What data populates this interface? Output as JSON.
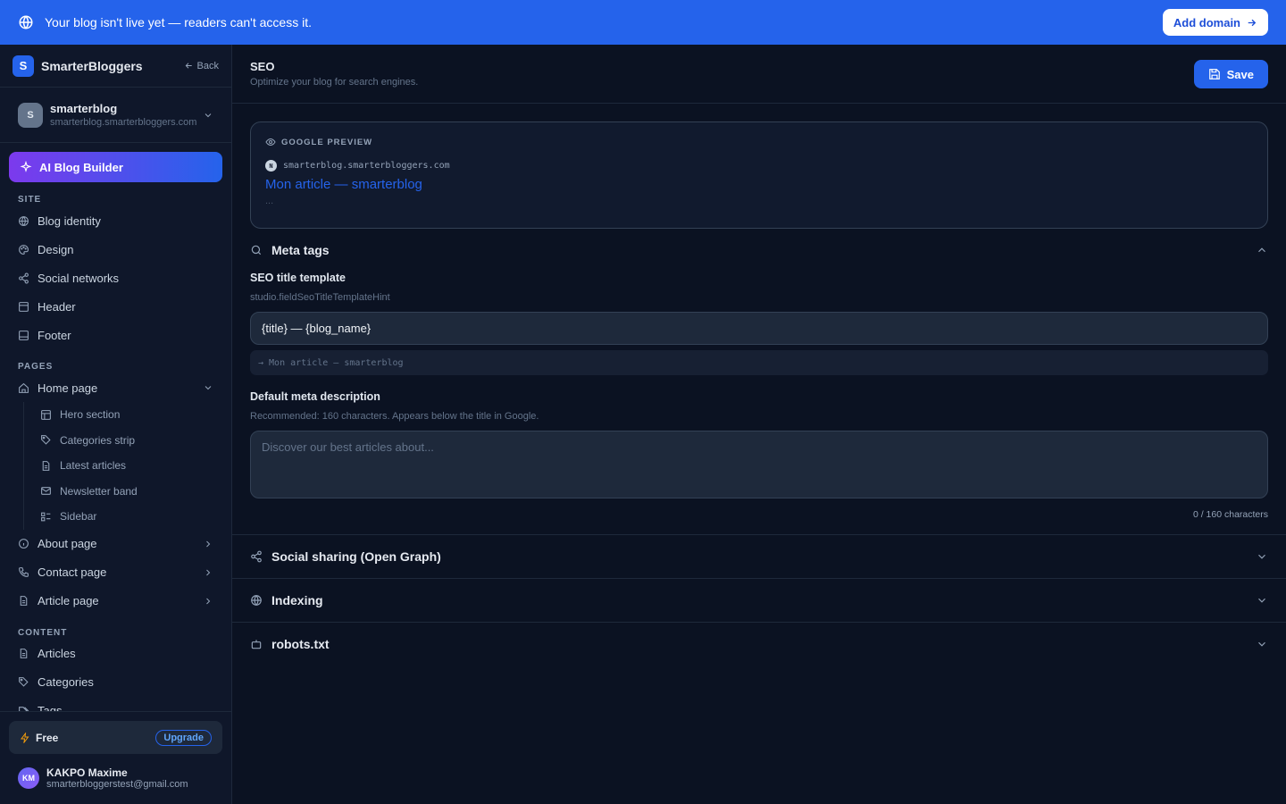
{
  "banner": {
    "message": "Your blog isn't live yet — readers can't access it.",
    "button": "Add domain"
  },
  "brand": {
    "logo": "S",
    "name": "SmarterBloggers",
    "back": "Back"
  },
  "blog": {
    "initial": "S",
    "name": "smarterblog",
    "domain": "smarterblog.smarterbloggers.com"
  },
  "ai_button": "AI Blog Builder",
  "nav": {
    "site_label": "SITE",
    "site": [
      {
        "label": "Blog identity",
        "icon": "globe-icon"
      },
      {
        "label": "Design",
        "icon": "palette-icon"
      },
      {
        "label": "Social networks",
        "icon": "share-icon"
      },
      {
        "label": "Header",
        "icon": "header-icon"
      },
      {
        "label": "Footer",
        "icon": "footer-icon"
      }
    ],
    "pages_label": "PAGES",
    "home": "Home page",
    "home_sub": [
      "Hero section",
      "Categories strip",
      "Latest articles",
      "Newsletter band",
      "Sidebar"
    ],
    "pages": [
      "About page",
      "Contact page",
      "Article page"
    ],
    "content_label": "CONTENT",
    "content": [
      "Articles",
      "Categories",
      "Tags"
    ]
  },
  "plan": {
    "name": "Free",
    "upgrade": "Upgrade"
  },
  "user": {
    "initials": "KM",
    "name": "KAKPO Maxime",
    "email": "smarterbloggerstest@gmail.com"
  },
  "header": {
    "title": "SEO",
    "subtitle": "Optimize your blog for search engines.",
    "save": "Save"
  },
  "preview": {
    "label": "GOOGLE PREVIEW",
    "favicon": "N",
    "url": "smarterblog.smarterbloggers.com",
    "title": "Mon article — smarterblog",
    "description": "..."
  },
  "meta": {
    "section": "Meta tags",
    "title_label": "SEO title template",
    "title_hint": "studio.fieldSeoTitleTemplateHint",
    "title_value": "{title} — {blog_name}",
    "title_preview": "→ Mon article — smarterblog",
    "desc_label": "Default meta description",
    "desc_hint": "Recommended: 160 characters. Appears below the title in Google.",
    "desc_placeholder": "Discover our best articles about...",
    "desc_count": "0 / 160 characters"
  },
  "sections": [
    "Social sharing (Open Graph)",
    "Indexing",
    "robots.txt"
  ],
  "colors": {
    "accent": "#2563eb",
    "bg": "#0b1222",
    "panel": "#1e293b"
  }
}
